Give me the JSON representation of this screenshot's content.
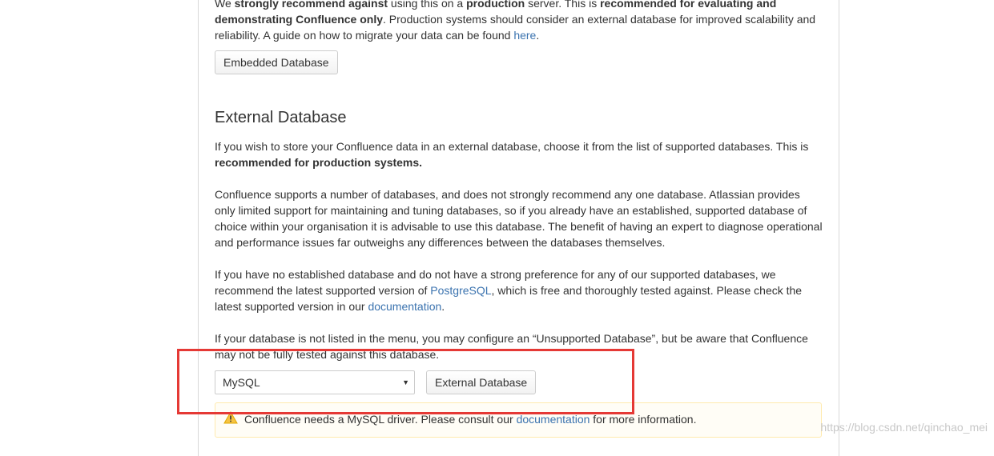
{
  "embedded": {
    "intro_1": "We ",
    "intro_bold_1": "strongly recommend against",
    "intro_2": " using this on a ",
    "intro_bold_2": "production",
    "intro_3": " server. This is ",
    "intro_bold_3": "recommended for evaluating and demonstrating Confluence only",
    "intro_4": ". Production systems should consider an external database for improved scalability and reliability. A guide on how to migrate your data can be found ",
    "intro_link": "here",
    "intro_5": ".",
    "button_label": "Embedded Database"
  },
  "external": {
    "title": "External Database",
    "p1_text": "If you wish to store your Confluence data in an external database, choose it from the list of supported databases. This is ",
    "p1_bold": "recommended for production systems.",
    "p2_text": "Confluence supports a number of databases, and does not strongly recommend any one database. Atlassian provides only limited support for maintaining and tuning databases, so if you already have an established, supported database of choice within your organisation it is advisable to use this database. The benefit of having an expert to diagnose operational and performance issues far outweighs any differences between the databases themselves.",
    "p3_text_1": "If you have no established database and do not have a strong preference for any of our supported databases, we recommend the latest supported version of ",
    "p3_link_1": "PostgreSQL",
    "p3_text_2": ", which is free and thoroughly tested against. Please check the latest supported version in our ",
    "p3_link_2": "documentation",
    "p3_text_3": ".",
    "p4_text": "If your database is not listed in the menu, you may configure an “Unsupported Database”, but be aware that Confluence may not be fully tested against this database.",
    "select_value": "MySQL",
    "button_label": "External Database",
    "warning_text_1": "Confluence needs a MySQL driver. Please consult our ",
    "warning_link": "documentation",
    "warning_text_2": " for more information."
  },
  "watermark": "https://blog.csdn.net/qinchao_mei",
  "colors": {
    "link": "#3b73af",
    "highlight_border": "#e53935",
    "warning_bg": "#fffdf6",
    "warning_border": "#ffeaae"
  },
  "icons": {
    "warning": "warning-icon",
    "select_arrow": "caret-down-icon"
  }
}
